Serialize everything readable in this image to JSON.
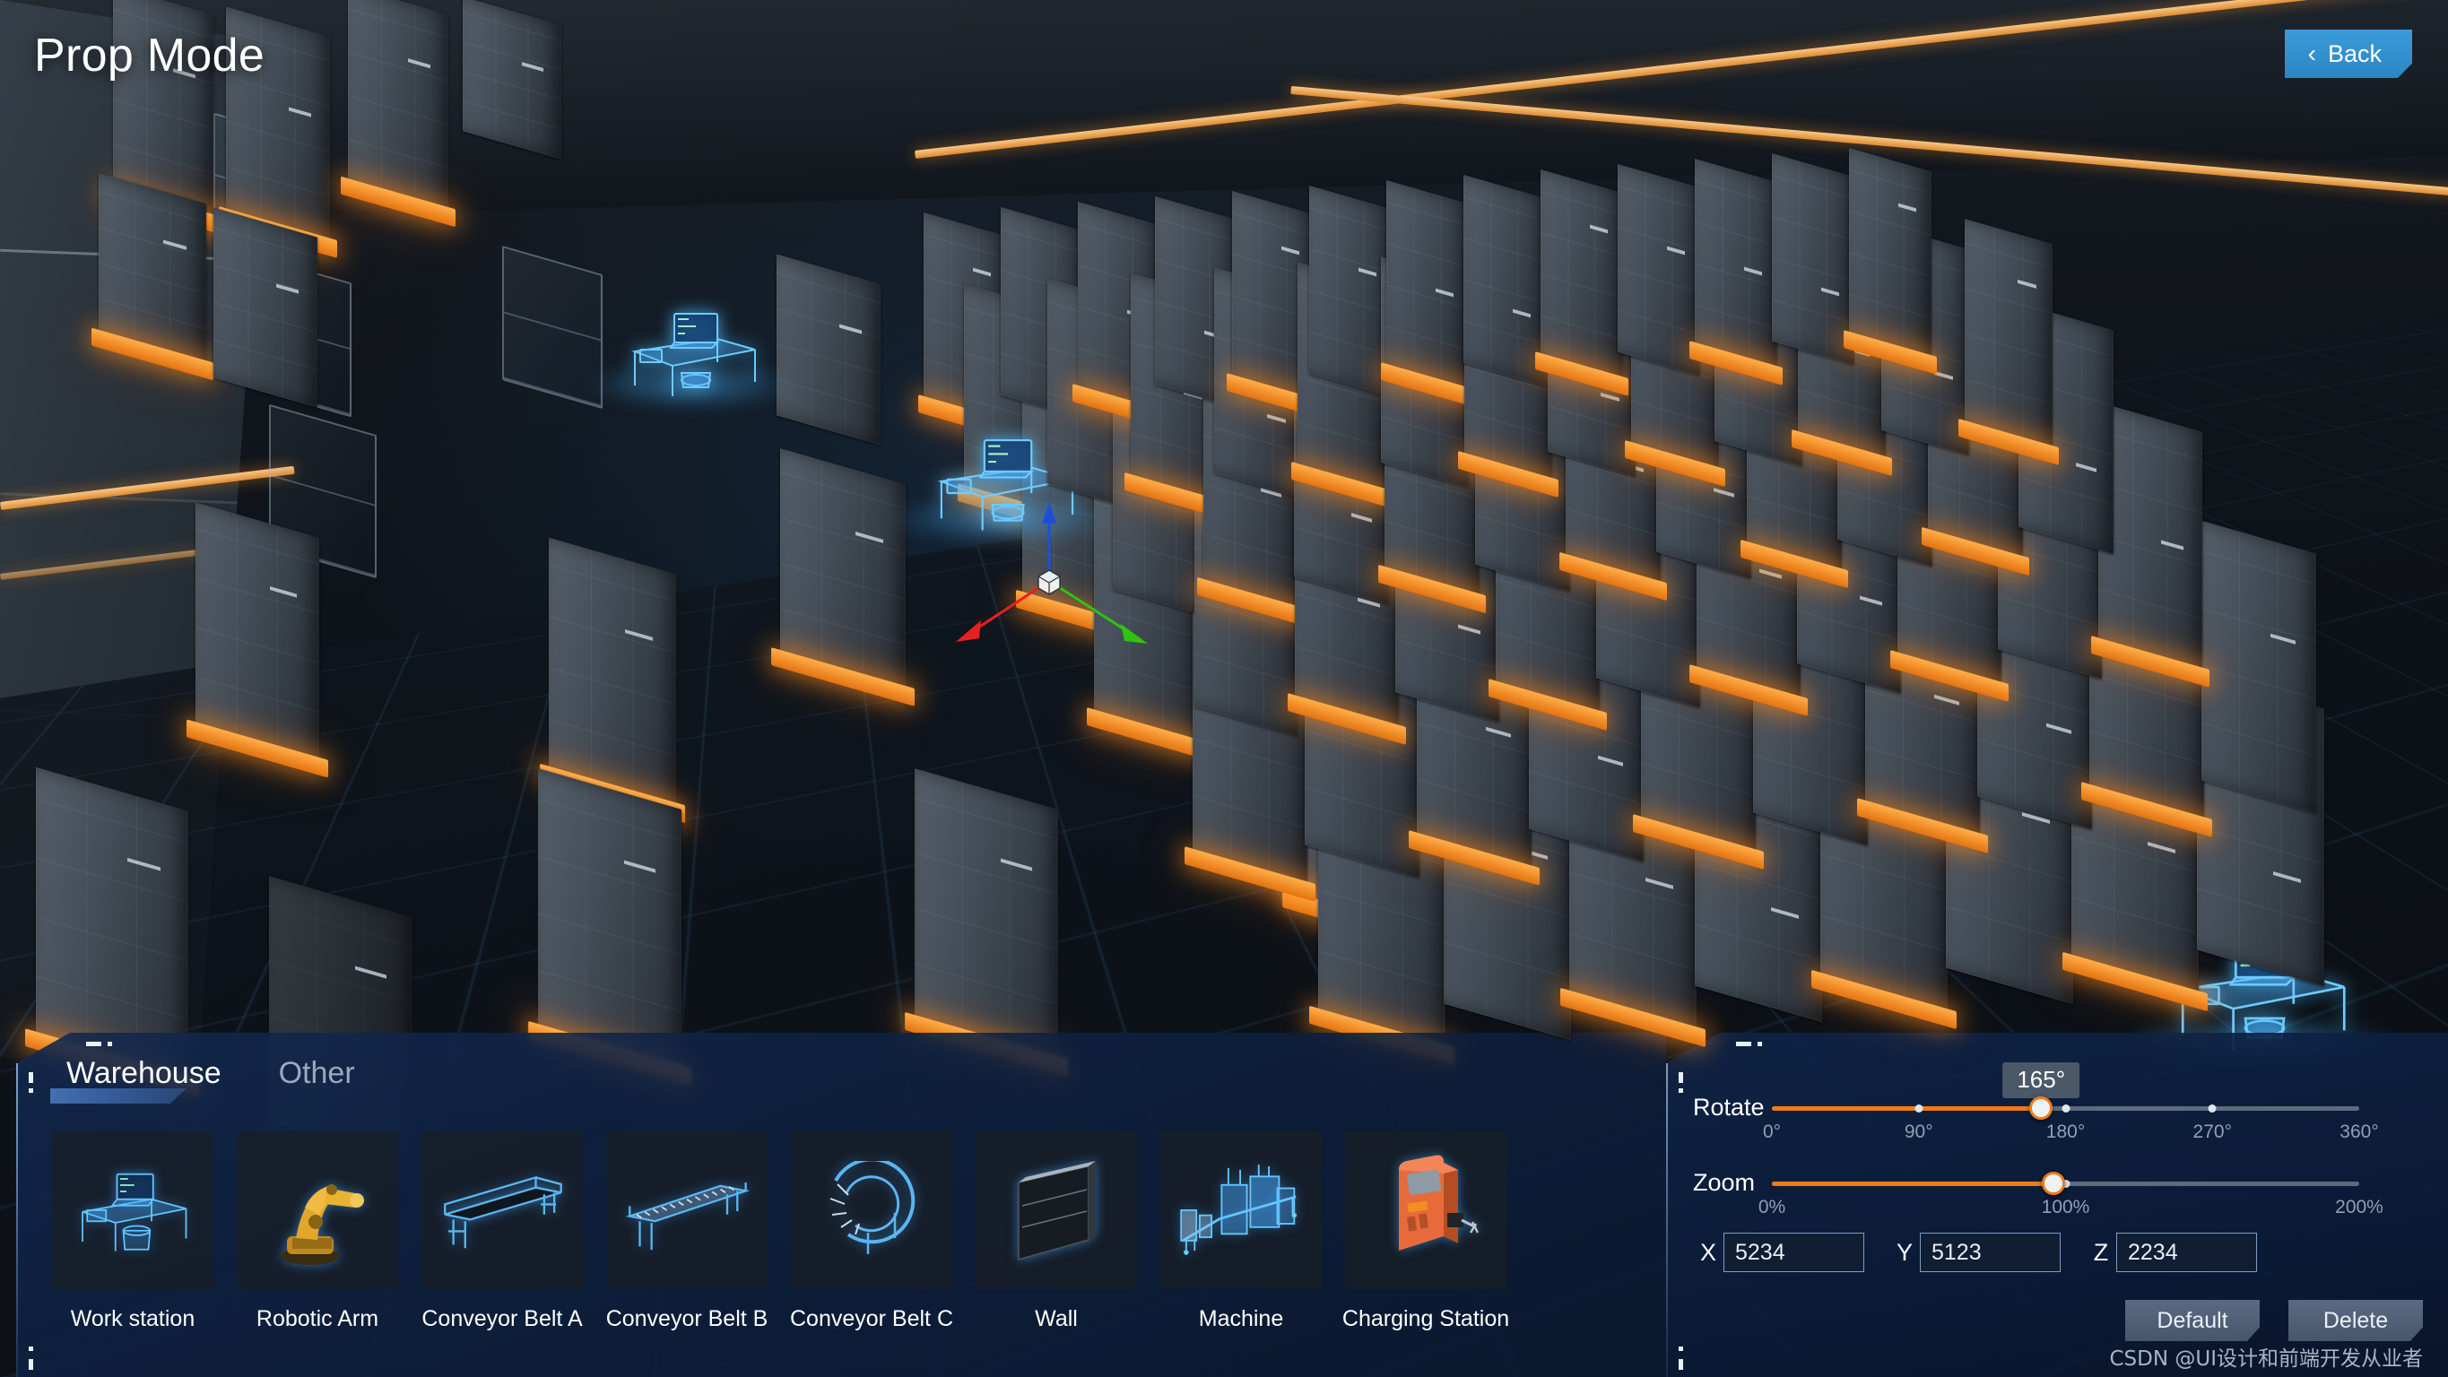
{
  "header": {
    "title": "Prop Mode",
    "back_label": "Back",
    "back_icon": "chevron-left-icon"
  },
  "props_panel": {
    "tabs": [
      {
        "label": "Warehouse",
        "active": true
      },
      {
        "label": "Other",
        "active": false
      }
    ],
    "items": [
      {
        "label": "Work station",
        "icon": "workstation-hologram-icon"
      },
      {
        "label": "Robotic Arm",
        "icon": "robotic-arm-icon"
      },
      {
        "label": "Conveyor Belt A",
        "icon": "conveyor-belt-a-icon"
      },
      {
        "label": "Conveyor Belt B",
        "icon": "conveyor-belt-b-icon"
      },
      {
        "label": "Conveyor Belt C",
        "icon": "conveyor-belt-c-icon"
      },
      {
        "label": "Wall",
        "icon": "wall-icon"
      },
      {
        "label": "Machine",
        "icon": "machine-icon"
      },
      {
        "label": "Charging Station",
        "icon": "charging-station-icon"
      }
    ]
  },
  "transform_panel": {
    "rotate": {
      "label": "Rotate",
      "value_display": "165°",
      "value": 165,
      "min": 0,
      "max": 360,
      "ticks": [
        "0°",
        "90°",
        "180°",
        "270°",
        "360°"
      ]
    },
    "zoom": {
      "label": "Zoom",
      "value": 96,
      "min": 0,
      "max": 200,
      "ticks": [
        "0%",
        "100%",
        "200%"
      ]
    },
    "coords": [
      {
        "axis": "X",
        "value": "5234"
      },
      {
        "axis": "Y",
        "value": "5123"
      },
      {
        "axis": "Z",
        "value": "2234"
      }
    ],
    "buttons": [
      {
        "label": "Default"
      },
      {
        "label": "Delete"
      }
    ]
  },
  "scene": {
    "gizmo": {
      "x_axis_color": "#e81f1f",
      "y_axis_color": "#2ec40f",
      "z_axis_color": "#1c4fd8"
    },
    "accent_orange": "#f07b18",
    "accent_blue": "#3b9bd9",
    "hologram_cyan": "#5ec8ff"
  },
  "watermark": "CSDN @UI设计和前端开发从业者"
}
